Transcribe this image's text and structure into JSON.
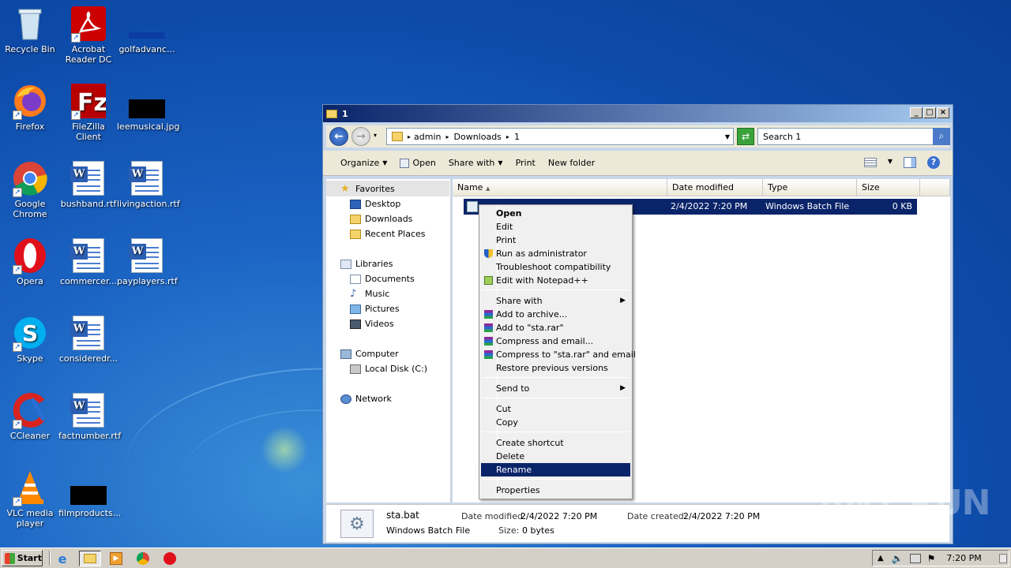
{
  "desktop": {
    "icons": [
      {
        "label": "Recycle Bin",
        "icon": "recycle-bin-icon"
      },
      {
        "label": "Acrobat Reader DC",
        "icon": "acrobat-icon"
      },
      {
        "label": "golfadvanc...",
        "icon": "file-thumbnail-icon"
      },
      {
        "label": "Firefox",
        "icon": "firefox-icon"
      },
      {
        "label": "FileZilla Client",
        "icon": "filezilla-icon"
      },
      {
        "label": "leemusical.jpg",
        "icon": "image-file-icon"
      },
      {
        "label": "Google Chrome",
        "icon": "chrome-icon"
      },
      {
        "label": "bushband.rtf",
        "icon": "rtf-file-icon"
      },
      {
        "label": "livingaction.rtf",
        "icon": "rtf-file-icon"
      },
      {
        "label": "Opera",
        "icon": "opera-icon"
      },
      {
        "label": "commercer...",
        "icon": "rtf-file-icon"
      },
      {
        "label": "payplayers.rtf",
        "icon": "rtf-file-icon"
      },
      {
        "label": "Skype",
        "icon": "skype-icon"
      },
      {
        "label": "consideredr...",
        "icon": "rtf-file-icon"
      },
      {
        "label": "CCleaner",
        "icon": "ccleaner-icon"
      },
      {
        "label": "factnumber.rtf",
        "icon": "rtf-file-icon"
      },
      {
        "label": "VLC media player",
        "icon": "vlc-icon"
      },
      {
        "label": "filmproducts...",
        "icon": "file-thumbnail-icon"
      }
    ]
  },
  "explorer": {
    "title": "1",
    "address": {
      "crumbs": [
        "admin",
        "Downloads",
        "1"
      ]
    },
    "search": {
      "placeholder": "Search 1"
    },
    "toolbar": {
      "organize": "Organize",
      "open": "Open",
      "share_with": "Share with",
      "print": "Print",
      "new_folder": "New folder"
    },
    "nav": {
      "favorites": "Favorites",
      "desktop": "Desktop",
      "downloads": "Downloads",
      "recent": "Recent Places",
      "libraries": "Libraries",
      "documents": "Documents",
      "music": "Music",
      "pictures": "Pictures",
      "videos": "Videos",
      "computer": "Computer",
      "local_disk": "Local Disk (C:)",
      "network": "Network"
    },
    "columns": {
      "name": "Name",
      "date": "Date modified",
      "type": "Type",
      "size": "Size"
    },
    "file": {
      "name": "sta.bat",
      "date": "2/4/2022 7:20 PM",
      "type": "Windows Batch File",
      "size": "0 KB"
    },
    "details": {
      "name": "sta.bat",
      "type": "Windows Batch File",
      "date_modified_label": "Date modified:",
      "date_modified": "2/4/2022 7:20 PM",
      "date_created_label": "Date created:",
      "date_created": "2/4/2022 7:20 PM",
      "size_label": "Size:",
      "size": "0 bytes"
    }
  },
  "context_menu": {
    "open": "Open",
    "edit": "Edit",
    "print": "Print",
    "run_admin": "Run as administrator",
    "troubleshoot": "Troubleshoot compatibility",
    "notepad": "Edit with Notepad++",
    "share_with": "Share with",
    "add_archive": "Add to archive...",
    "add_rar": "Add to \"sta.rar\"",
    "compress_email": "Compress and email...",
    "compress_rar_email": "Compress to \"sta.rar\" and email",
    "restore": "Restore previous versions",
    "send_to": "Send to",
    "cut": "Cut",
    "copy": "Copy",
    "create_shortcut": "Create shortcut",
    "delete": "Delete",
    "rename": "Rename",
    "properties": "Properties"
  },
  "taskbar": {
    "start": "Start",
    "clock": "7:20 PM"
  },
  "watermark": "ANY RUN"
}
